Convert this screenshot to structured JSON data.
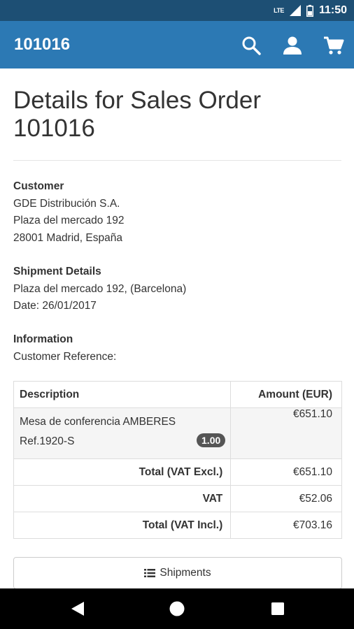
{
  "status_bar": {
    "network": "LTE",
    "time": "11:50"
  },
  "app_bar": {
    "title": "101016",
    "icons": [
      "search-icon",
      "user-icon",
      "cart-icon"
    ]
  },
  "page": {
    "title": "Details for Sales Order 101016"
  },
  "customer": {
    "heading": "Customer",
    "name": "GDE Distribución S.A.",
    "address1": "Plaza del mercado 192",
    "address2": "28001 Madrid, España"
  },
  "shipment": {
    "heading": "Shipment Details",
    "address": "Plaza del mercado 192, (Barcelona)",
    "date": "Date: 26/01/2017"
  },
  "information": {
    "heading": "Information",
    "reference": "Customer Reference:"
  },
  "table": {
    "headers": {
      "description": "Description",
      "amount": "Amount (EUR)"
    },
    "items": [
      {
        "name": "Mesa de conferencia AMBERES",
        "ref": "Ref.1920-S",
        "qty": "1.00",
        "amount": "€651.10"
      }
    ],
    "totals": [
      {
        "label": "Total (VAT Excl.)",
        "value": "€651.10"
      },
      {
        "label": "VAT",
        "value": "€52.06"
      },
      {
        "label": "Total (VAT Incl.)",
        "value": "€703.16"
      }
    ]
  },
  "actions": {
    "shipments_label": "Shipments"
  },
  "colors": {
    "app_bar": "#2c79b4",
    "status_bar": "#1d4f74",
    "badge": "#555555"
  }
}
